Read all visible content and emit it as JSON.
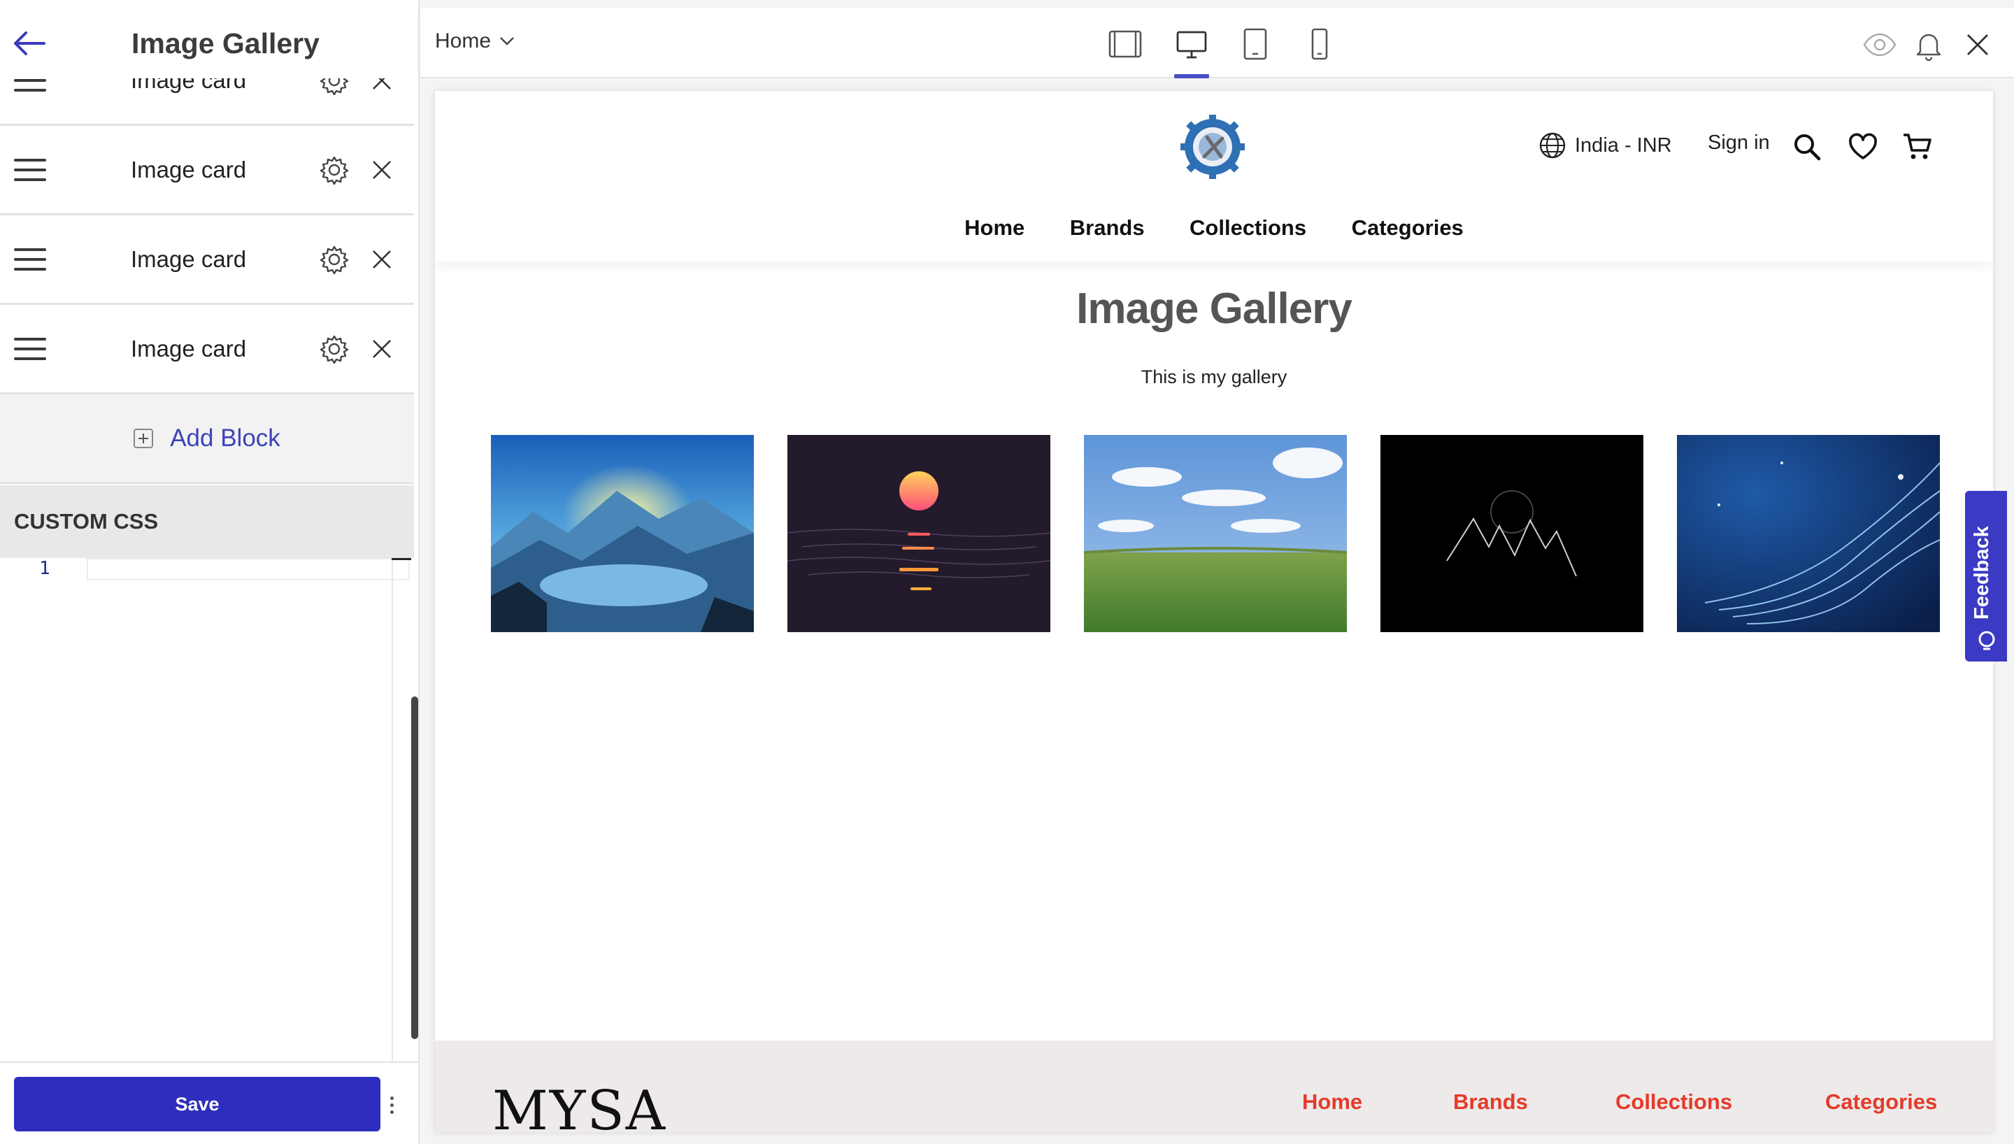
{
  "sidebar": {
    "title": "Image Gallery",
    "blocks": [
      {
        "label": "Image card"
      },
      {
        "label": "Image card"
      },
      {
        "label": "Image card"
      },
      {
        "label": "Image card"
      }
    ],
    "add_block_label": "Add Block",
    "custom_css_heading": "CUSTOM CSS",
    "editor_line_number": "1",
    "save_label": "Save"
  },
  "toolbar": {
    "page_selector": "Home",
    "devices": [
      "fullscreen",
      "desktop",
      "tablet",
      "mobile"
    ],
    "active_device": "desktop"
  },
  "preview": {
    "header": {
      "locale": "India - INR",
      "sign_in": "Sign in",
      "nav": [
        "Home",
        "Brands",
        "Collections",
        "Categories"
      ]
    },
    "gallery": {
      "title": "Image Gallery",
      "subtitle": "This is my gallery",
      "images": [
        {
          "name": "mountain-lake-image"
        },
        {
          "name": "sunset-sea-image"
        },
        {
          "name": "green-meadow-image"
        },
        {
          "name": "dark-mountains-image"
        },
        {
          "name": "blue-waves-image"
        }
      ]
    },
    "footer": {
      "brand": "MYSA",
      "nav": [
        "Home",
        "Brands",
        "Collections",
        "Categories"
      ],
      "link_color": "#e53a2a"
    }
  },
  "feedback_label": "Feedback",
  "colors": {
    "accent": "#2e2ebe",
    "link": "#3c43b8",
    "active_tab": "#4a4cc4"
  }
}
